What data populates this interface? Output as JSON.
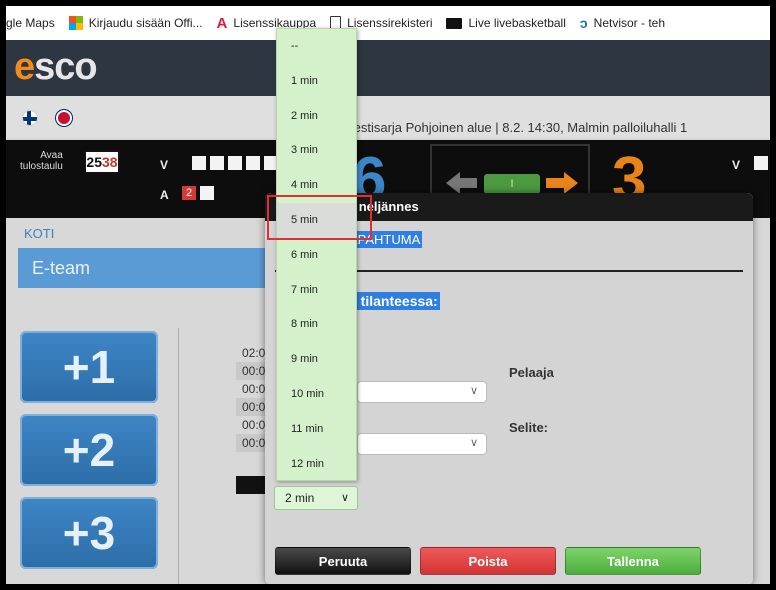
{
  "bookmarks": [
    {
      "label": "gle Maps",
      "icon": "none"
    },
    {
      "label": "Kirjaudu sisään Offi...",
      "icon": "microsoft-icon"
    },
    {
      "label": "Lisenssikauppa",
      "icon": "a-logo-icon"
    },
    {
      "label": "Lisenssirekisteri",
      "icon": "document-icon"
    },
    {
      "label": "Live livebasketball",
      "icon": "tv-icon"
    },
    {
      "label": "Netvisor - teh",
      "icon": "netvisor-icon"
    }
  ],
  "header": {
    "logo_e": "e",
    "logo_rest": "sco"
  },
  "match": {
    "info": "testisarja Pohjoinen alue | 8.2. 14:30, Malmin palloiluhalli 1"
  },
  "scoreboard": {
    "tulostaulu_line1": "Avaa",
    "tulostaulu_line2": "tulostaulu",
    "icon_left": "25",
    "icon_right": "38",
    "home_v": "V",
    "home_a": "A",
    "home_a_count": "2",
    "home_score": "6",
    "away_score": "3",
    "away_v": "V",
    "period_indicator": "I"
  },
  "home": {
    "side_label": "KOTI",
    "team_name": "E-team"
  },
  "score_buttons": [
    "+1",
    "+2",
    "+3"
  ],
  "time_rows": [
    "02:0",
    "00:0",
    "00:0",
    "00:0",
    "00:0",
    "00:0"
  ],
  "modal": {
    "title": "| 1. neljännes",
    "event_tag": "APAHTUMA",
    "situation_tag": "a tilanteessa:",
    "player_label": "Pelaaja",
    "colon_label": ":",
    "note_label": "Selite:",
    "cancel": "Peruuta",
    "delete": "Poista",
    "save": "Tallenna"
  },
  "time_select": {
    "value": "2 min"
  },
  "dropdown": {
    "options": [
      "--",
      "1 min",
      "2 min",
      "3 min",
      "4 min",
      "5 min",
      "6 min",
      "7 min",
      "8 min",
      "9 min",
      "10 min",
      "11 min",
      "12 min"
    ],
    "highlighted": "5 min"
  },
  "colors": {
    "accent": "#f28b1e",
    "header": "#2e3642",
    "team_blue": "#5b9bd5",
    "dropdown_bg": "#d4f1cc",
    "highlight_box": "#e0302e"
  }
}
